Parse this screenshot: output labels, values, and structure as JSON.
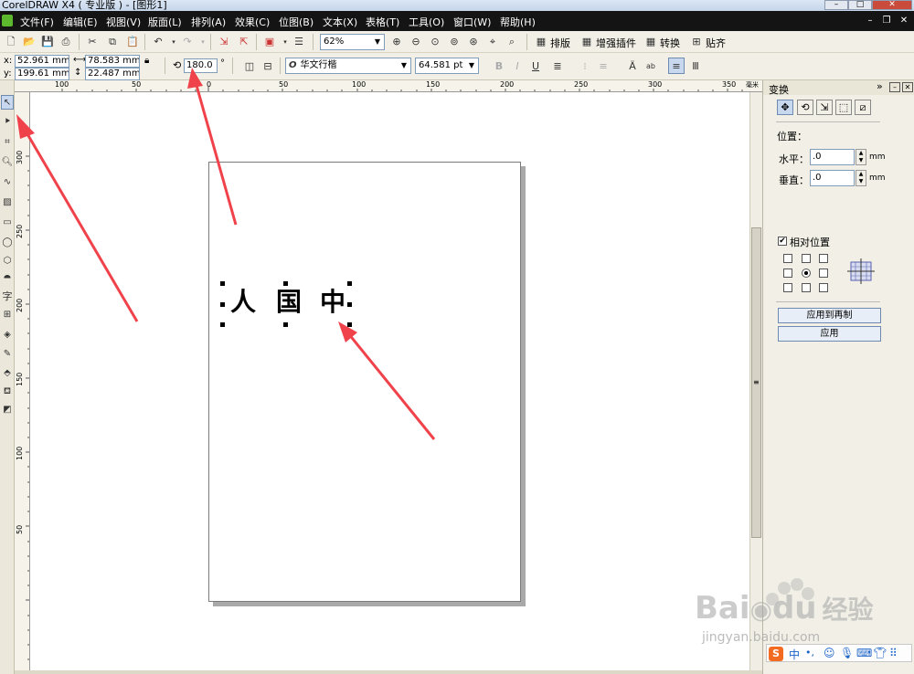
{
  "window": {
    "title": "CorelDRAW X4 ( 专业版 ) - [图形1]"
  },
  "menu": [
    "文件(F)",
    "编辑(E)",
    "视图(V)",
    "版面(L)",
    "排列(A)",
    "效果(C)",
    "位图(B)",
    "文本(X)",
    "表格(T)",
    "工具(O)",
    "窗口(W)",
    "帮助(H)"
  ],
  "toolbar": {
    "zoom": "62%",
    "layout_label": "排版",
    "enhance_label": "增强插件",
    "convert_label": "转换",
    "snap_label": "贴齐"
  },
  "property_bar": {
    "x_label": "x:",
    "x_value": "52.961 mm",
    "y_label": "y:",
    "y_value": "199.61 mm",
    "width": "78.583 mm",
    "height": "22.487 mm",
    "rotation": "180.0",
    "degree": "°",
    "font_name": "华文行楷",
    "font_size": "64.581 pt",
    "italic_glyph": "O"
  },
  "ruler": {
    "unit": "毫米",
    "h_labels": [
      "100",
      "50",
      "0",
      "50",
      "100",
      "150",
      "200",
      "250",
      "300",
      "350"
    ],
    "v_labels": [
      "300",
      "250",
      "200",
      "150",
      "100",
      "50"
    ]
  },
  "canvas_text": [
    "人",
    "国",
    "中"
  ],
  "docker": {
    "title": "变换",
    "position_label": "位置：",
    "horizontal_label": "水平：",
    "horizontal_value": ".0",
    "vertical_label": "垂直：",
    "vertical_value": ".0",
    "unit": "mm",
    "relative_label": "相对位置",
    "apply_copy_label": "应用到再制",
    "apply_label": "应用"
  },
  "watermark": {
    "brand": "Bai",
    "brand2": "du",
    "cn": "经验",
    "url": "jingyan.baidu.com"
  },
  "ime": {
    "mode": "中"
  },
  "colors": {
    "arrow": "#f0424a",
    "menubar": "#141414"
  }
}
